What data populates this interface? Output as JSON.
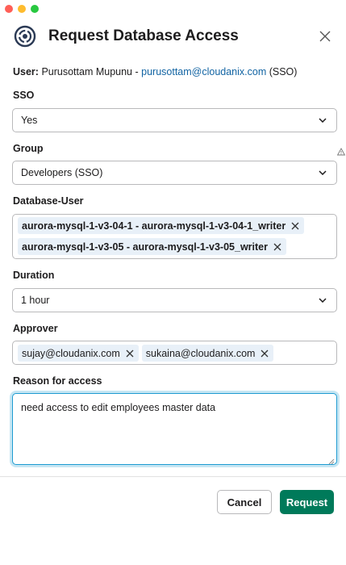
{
  "window": {
    "traffic_lights": [
      "close",
      "minimize",
      "zoom"
    ]
  },
  "header": {
    "title": "Request Database Access",
    "logo_icon": "cloudanix-logo-icon",
    "close_icon": "close-icon"
  },
  "user": {
    "label": "User:",
    "name": "Purusottam Mupunu - ",
    "email": "purusottam@cloudanix.com",
    "suffix": " (SSO)"
  },
  "sso": {
    "label": "SSO",
    "value": "Yes"
  },
  "group": {
    "label": "Group",
    "value": "Developers (SSO)"
  },
  "database_user": {
    "label": "Database-User",
    "selected": [
      "aurora-mysql-1-v3-04-1 - aurora-mysql-1-v3-04-1_writer",
      "aurora-mysql-1-v3-05 - aurora-mysql-1-v3-05_writer"
    ]
  },
  "duration": {
    "label": "Duration",
    "value": "1 hour"
  },
  "approver": {
    "label": "Approver",
    "selected": [
      "sujay@cloudanix.com",
      "sukaina@cloudanix.com"
    ]
  },
  "reason": {
    "label": "Reason for access",
    "value": "need access to edit employees master data"
  },
  "actions": {
    "cancel": "Cancel",
    "submit": "Request"
  },
  "colors": {
    "primary": "#007a5a",
    "link": "#1264a3",
    "focus": "#1d9bd1",
    "chip_bg": "#e8f0f8"
  }
}
